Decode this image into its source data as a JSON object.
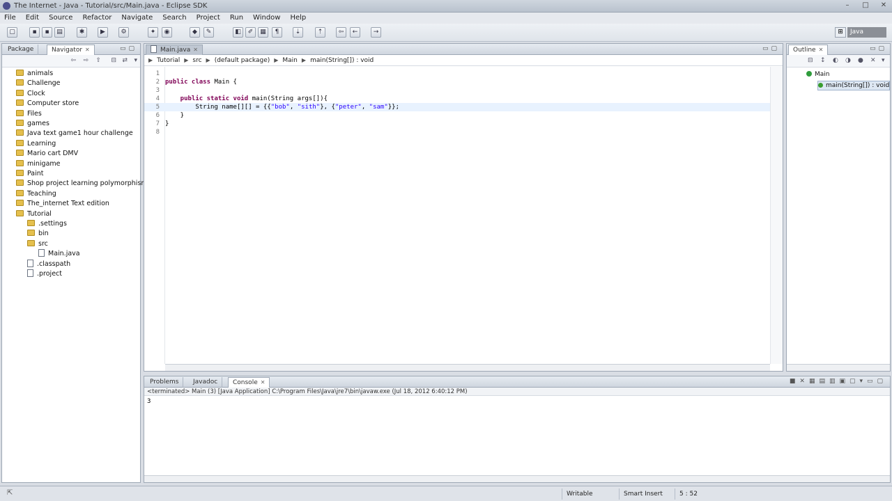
{
  "window": {
    "title": "The Internet - Java - Tutorial/src/Main.java - Eclipse SDK"
  },
  "menu": [
    "File",
    "Edit",
    "Source",
    "Refactor",
    "Navigate",
    "Search",
    "Project",
    "Run",
    "Window",
    "Help"
  ],
  "perspectives": {
    "java_label": "Java"
  },
  "left_panel": {
    "tabs": [
      {
        "label": "Package"
      },
      {
        "label": "Navigator"
      }
    ],
    "tree": [
      {
        "label": "animals",
        "indent": 0,
        "type": "folder"
      },
      {
        "label": "Challenge",
        "indent": 0,
        "type": "folder"
      },
      {
        "label": "Clock",
        "indent": 0,
        "type": "folder"
      },
      {
        "label": "Computer store",
        "indent": 0,
        "type": "folder"
      },
      {
        "label": "Files",
        "indent": 0,
        "type": "folder"
      },
      {
        "label": "games",
        "indent": 0,
        "type": "folder"
      },
      {
        "label": "Java text game1 hour challenge",
        "indent": 0,
        "type": "folder"
      },
      {
        "label": "Learning",
        "indent": 0,
        "type": "folder"
      },
      {
        "label": "Mario cart DMV",
        "indent": 0,
        "type": "folder"
      },
      {
        "label": "minigame",
        "indent": 0,
        "type": "folder"
      },
      {
        "label": "Paint",
        "indent": 0,
        "type": "folder"
      },
      {
        "label": "Shop project learning polymorphism",
        "indent": 0,
        "type": "folder"
      },
      {
        "label": "Teaching",
        "indent": 0,
        "type": "folder"
      },
      {
        "label": "The_internet Text edition",
        "indent": 0,
        "type": "folder"
      },
      {
        "label": "Tutorial",
        "indent": 0,
        "type": "folder"
      },
      {
        "label": ".settings",
        "indent": 1,
        "type": "folder"
      },
      {
        "label": "bin",
        "indent": 1,
        "type": "folder"
      },
      {
        "label": "src",
        "indent": 1,
        "type": "folder"
      },
      {
        "label": "Main.java",
        "indent": 2,
        "type": "file"
      },
      {
        "label": ".classpath",
        "indent": 1,
        "type": "file"
      },
      {
        "label": ".project",
        "indent": 1,
        "type": "file"
      }
    ]
  },
  "editor": {
    "tab_label": "Main.java",
    "breadcrumb": [
      "Tutorial",
      "src",
      "(default package)",
      "Main",
      "main(String[]) : void"
    ],
    "lines": [
      {
        "n": "1",
        "segments": []
      },
      {
        "n": "2",
        "segments": [
          {
            "t": "public class ",
            "k": "kw"
          },
          {
            "t": "Main {",
            "k": ""
          }
        ]
      },
      {
        "n": "3",
        "segments": []
      },
      {
        "n": "4",
        "segments": [
          {
            "t": "    public static void ",
            "k": "kw"
          },
          {
            "t": "main(String args[]){",
            "k": ""
          }
        ]
      },
      {
        "n": "5",
        "segments": [
          {
            "t": "        String ",
            "k": ""
          },
          {
            "t": "name",
            "k": ""
          },
          {
            "t": "[][] = {{",
            "k": ""
          },
          {
            "t": "\"bob\"",
            "k": "str"
          },
          {
            "t": ", ",
            "k": ""
          },
          {
            "t": "\"sith\"",
            "k": "str"
          },
          {
            "t": "}, {",
            "k": ""
          },
          {
            "t": "\"peter\"",
            "k": "str"
          },
          {
            "t": ", ",
            "k": ""
          },
          {
            "t": "\"sam\"",
            "k": "str"
          },
          {
            "t": "}};",
            "k": ""
          }
        ]
      },
      {
        "n": "6",
        "segments": [
          {
            "t": "    }",
            "k": ""
          }
        ]
      },
      {
        "n": "7",
        "segments": [
          {
            "t": "}",
            "k": ""
          }
        ]
      },
      {
        "n": "8",
        "segments": []
      }
    ]
  },
  "outline": {
    "tab_label": "Outline",
    "items": [
      {
        "label": "Main"
      },
      {
        "label": "main(String[]) : void"
      }
    ]
  },
  "bottom_panel": {
    "tabs": [
      {
        "label": "Problems"
      },
      {
        "label": "Javadoc"
      },
      {
        "label": "Console"
      }
    ],
    "console_header": "<terminated> Main (3) [Java Application] C:\\Program Files\\Java\\jre7\\bin\\javaw.exe (Jul 18, 2012 6:40:12 PM)",
    "output": "3"
  },
  "status": {
    "writable": "Writable",
    "insert_mode": "Smart Insert",
    "position": "5 : 52"
  }
}
